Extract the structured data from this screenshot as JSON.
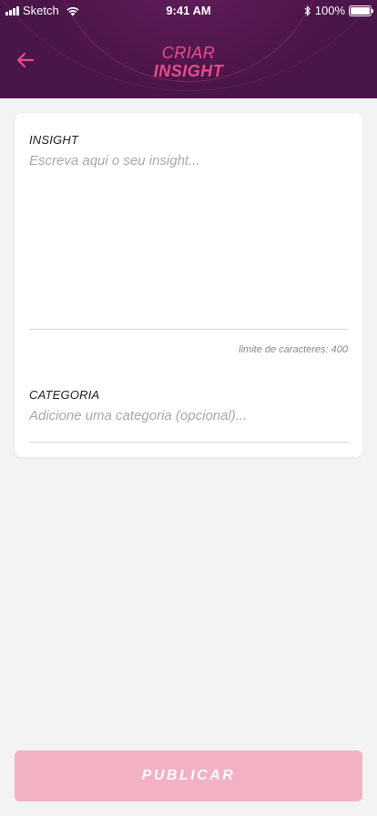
{
  "status_bar": {
    "carrier": "Sketch",
    "time": "9:41 AM",
    "battery_percent": "100%"
  },
  "header": {
    "back_icon": "arrow-left-icon",
    "title_line1": "CRIAR",
    "title_line2": "INSIGHT"
  },
  "form": {
    "insight_label": "INSIGHT",
    "insight_placeholder": "Escreva aqui o seu insight...",
    "char_limit_text": "limite de caracteres: 400",
    "category_label": "CATEGORIA",
    "category_placeholder": "Adicione uma categoria (opcional)..."
  },
  "actions": {
    "publish_label": "PUBLICAR"
  },
  "colors": {
    "header_bg": "#4a1548",
    "accent": "#e94b8a",
    "button_disabled": "#f2b2c3",
    "page_bg": "#f3f3f3"
  }
}
